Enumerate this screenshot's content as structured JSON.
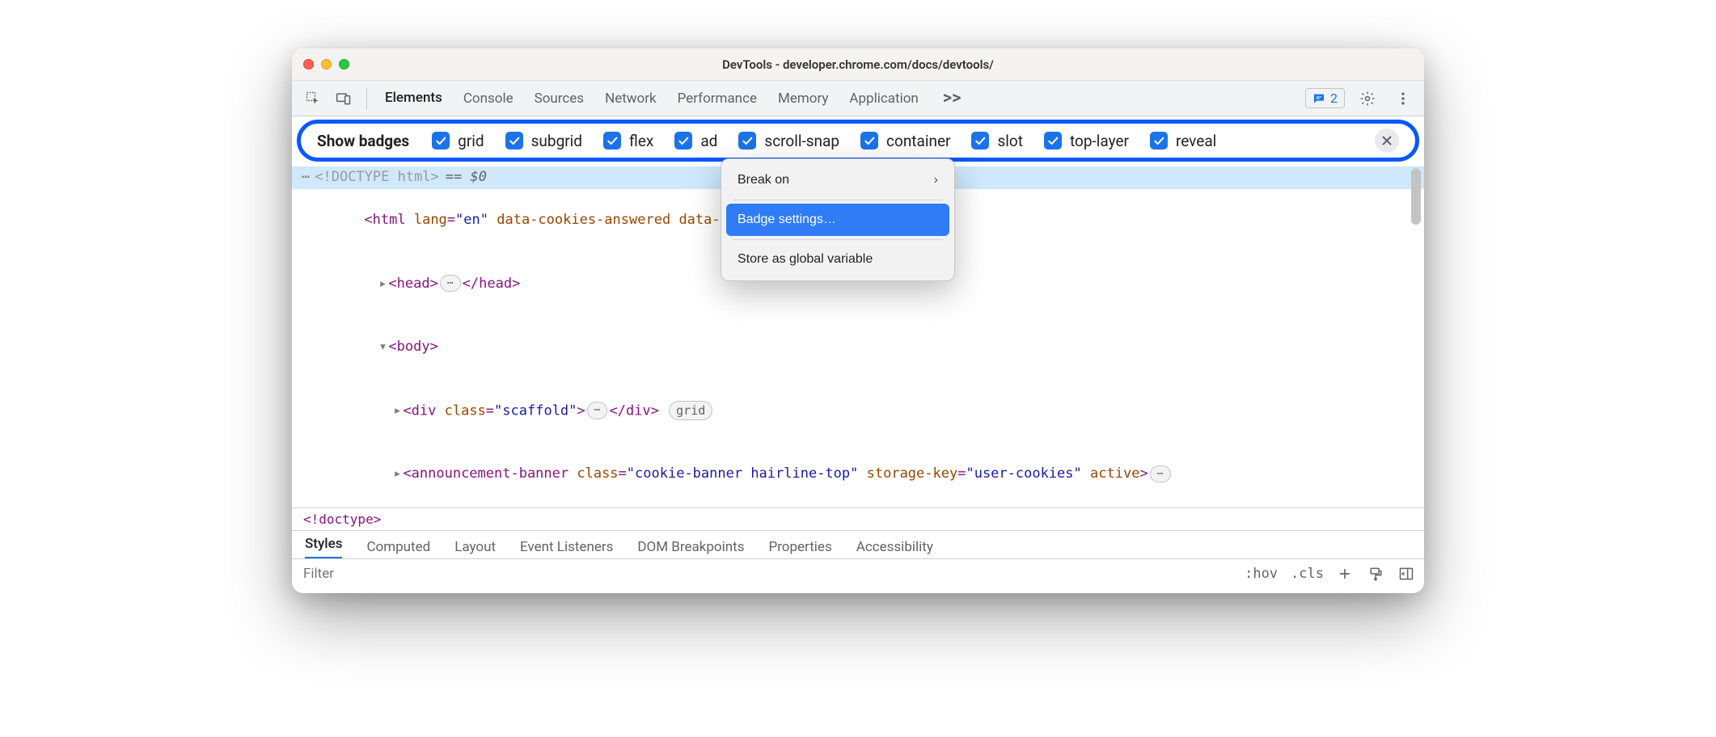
{
  "title": "DevTools - developer.chrome.com/docs/devtools/",
  "mainTabs": {
    "items": [
      "Elements",
      "Console",
      "Sources",
      "Network",
      "Performance",
      "Memory",
      "Application"
    ],
    "active": "Elements",
    "moreGlyph": ">>"
  },
  "issueCount": "2",
  "badges": {
    "label": "Show badges",
    "items": [
      "grid",
      "subgrid",
      "flex",
      "ad",
      "scroll-snap",
      "container",
      "slot",
      "top-layer",
      "reveal"
    ]
  },
  "contextMenu": {
    "items": [
      {
        "label": "Break on",
        "submenu": true
      },
      {
        "label": "Badge settings…",
        "highlight": true
      },
      {
        "label": "Store as global variable"
      }
    ]
  },
  "dom": {
    "doctype": "<!DOCTYPE html>",
    "selRef": "== $0",
    "htmlOpen": "<html lang=\"en\" data-cookies-answered data-",
    "headOpen": "<head>",
    "headClose": "</head>",
    "bodyOpen": "<body>",
    "divOpen": "<div class=\"scaffold\">",
    "divClose": "</div>",
    "divBadge": "grid",
    "annOpen": "<announcement-banner class=\"cookie-banner hairline-top\" storage-key=\"user-cookies\" active>",
    "ellip": "⋯"
  },
  "breadcrumb": "<!doctype>",
  "subTabs": {
    "items": [
      "Styles",
      "Computed",
      "Layout",
      "Event Listeners",
      "DOM Breakpoints",
      "Properties",
      "Accessibility"
    ],
    "active": "Styles"
  },
  "filterPlaceholder": "Filter",
  "hov": ":hov",
  "cls": ".cls"
}
